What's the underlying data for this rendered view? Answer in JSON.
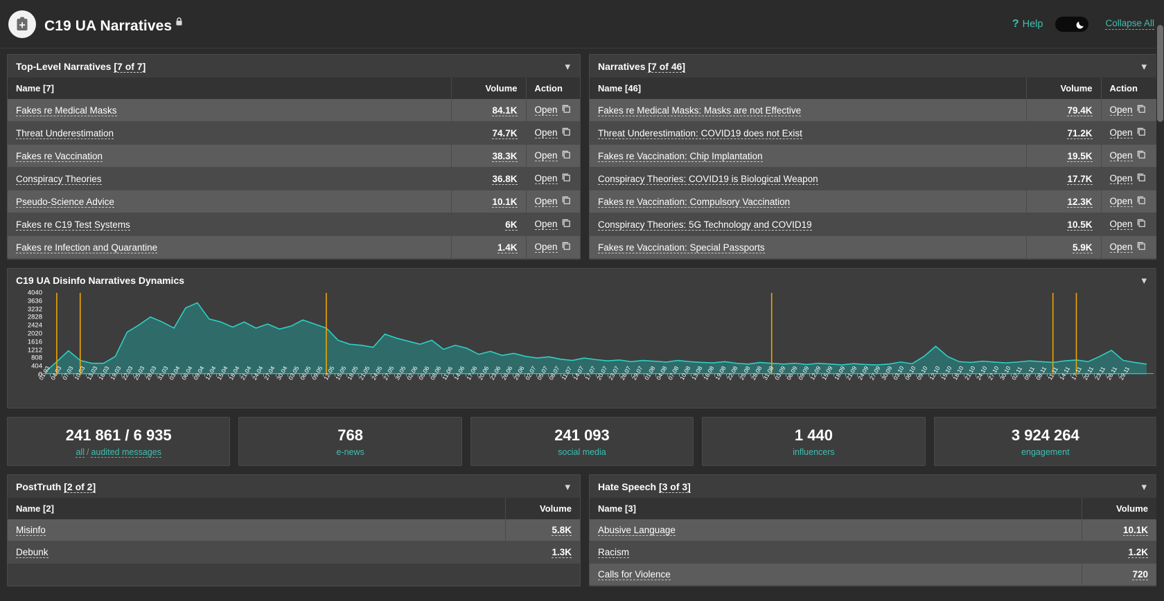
{
  "header": {
    "app_title": "C19 UA Narratives",
    "lock_icon": "lock-icon",
    "logo_icon": "clipboard-plus-icon",
    "help_label": "Help",
    "help_icon": "question-mark-icon",
    "theme_toggle_icon": "moon-icon",
    "collapse_all_label": "Collapse All",
    "accent_color": "#3fbfb0"
  },
  "top_level_narratives": {
    "title": "Top-Level Narratives",
    "count_label": "[7 of 7]",
    "chevron_icon": "chevron-down-icon",
    "columns": [
      "Name [7]",
      "Volume",
      "Action"
    ],
    "action_label": "Open",
    "action_icon": "copy-icon",
    "rows": [
      {
        "name": "Fakes re Medical Masks",
        "volume": "84.1K"
      },
      {
        "name": "Threat Underestimation",
        "volume": "74.7K"
      },
      {
        "name": "Fakes re Vaccination",
        "volume": "38.3K"
      },
      {
        "name": "Conspiracy Theories",
        "volume": "36.8K"
      },
      {
        "name": "Pseudo-Science Advice",
        "volume": "10.1K"
      },
      {
        "name": "Fakes re C19 Test Systems",
        "volume": "6K"
      },
      {
        "name": "Fakes re Infection and Quarantine",
        "volume": "1.4K"
      }
    ]
  },
  "narratives": {
    "title": "Narratives",
    "count_label": "[7 of 46]",
    "chevron_icon": "chevron-down-icon",
    "columns": [
      "Name [46]",
      "Volume",
      "Action"
    ],
    "action_label": "Open",
    "action_icon": "copy-icon",
    "rows": [
      {
        "name": "Fakes re Medical Masks: Masks are not Effective",
        "volume": "79.4K"
      },
      {
        "name": "Threat Underestimation: COVID19 does not Exist",
        "volume": "71.2K"
      },
      {
        "name": "Fakes re Vaccination: Chip Implantation",
        "volume": "19.5K"
      },
      {
        "name": "Conspiracy Theories: COVID19 is Biological Weapon",
        "volume": "17.7K"
      },
      {
        "name": "Fakes re Vaccination: Compulsory Vaccination",
        "volume": "12.3K"
      },
      {
        "name": "Conspiracy Theories: 5G Technology and COVID19",
        "volume": "10.5K"
      },
      {
        "name": "Fakes re Vaccination: Special Passports",
        "volume": "5.9K"
      }
    ]
  },
  "dynamics_panel": {
    "title": "C19 UA Disinfo Narratives Dynamics",
    "chevron_icon": "chevron-down-icon"
  },
  "chart_data": {
    "type": "area",
    "title": "C19 UA Disinfo Narratives Dynamics",
    "xlabel": "",
    "ylabel": "",
    "ylim": [
      0,
      4040
    ],
    "grid": false,
    "legend": "none",
    "line_color": "#2fd0c5",
    "fill_color": "#2f6b69",
    "marker_color": "#f0a500",
    "yticks": [
      4040,
      3636,
      3232,
      2828,
      2424,
      2020,
      1616,
      1212,
      808,
      404,
      0
    ],
    "markers_x": [
      "04.03",
      "10.03",
      "12.05",
      "03.09",
      "14.11",
      "20.11"
    ],
    "x": [
      "01.03",
      "04.03",
      "07.03",
      "10.03",
      "13.03",
      "16.03",
      "19.03",
      "22.03",
      "25.03",
      "28.03",
      "31.03",
      "03.04",
      "06.04",
      "09.04",
      "12.04",
      "15.04",
      "18.04",
      "21.04",
      "24.04",
      "27.04",
      "30.04",
      "03.05",
      "06.05",
      "09.05",
      "12.05",
      "15.05",
      "18.05",
      "21.05",
      "24.05",
      "27.05",
      "30.05",
      "02.06",
      "05.06",
      "08.06",
      "11.06",
      "14.06",
      "17.06",
      "20.06",
      "23.06",
      "26.06",
      "29.06",
      "02.07",
      "05.07",
      "08.07",
      "11.07",
      "14.07",
      "17.07",
      "20.07",
      "23.07",
      "26.07",
      "29.07",
      "01.08",
      "04.08",
      "07.08",
      "10.08",
      "13.08",
      "16.08",
      "19.08",
      "22.08",
      "25.08",
      "28.08",
      "31.08",
      "03.09",
      "06.09",
      "09.09",
      "12.09",
      "15.09",
      "18.09",
      "21.09",
      "24.09",
      "27.09",
      "30.09",
      "03.10",
      "06.10",
      "09.10",
      "12.10",
      "15.10",
      "18.10",
      "21.10",
      "24.10",
      "27.10",
      "30.10",
      "02.11",
      "05.11",
      "08.11",
      "11.11",
      "14.11",
      "17.11",
      "20.11",
      "23.11",
      "26.11",
      "29.11"
    ],
    "values": [
      120,
      640,
      1180,
      700,
      560,
      560,
      900,
      2100,
      2450,
      2850,
      2600,
      2300,
      3300,
      3550,
      2750,
      2600,
      2350,
      2600,
      2300,
      2500,
      2250,
      2400,
      2700,
      2500,
      2300,
      1700,
      1500,
      1450,
      1350,
      2000,
      1800,
      1650,
      1500,
      1700,
      1250,
      1450,
      1300,
      1000,
      1150,
      950,
      1050,
      900,
      820,
      880,
      760,
      700,
      820,
      740,
      680,
      720,
      640,
      700,
      660,
      620,
      700,
      640,
      600,
      580,
      640,
      560,
      520,
      600,
      560,
      520,
      560,
      500,
      560,
      520,
      480,
      540,
      500,
      480,
      520,
      620,
      540,
      900,
      1400,
      900,
      640,
      600,
      660,
      620,
      580,
      620,
      680,
      640,
      600,
      680,
      720,
      640,
      900,
      1200,
      700,
      600,
      520
    ]
  },
  "stats": [
    {
      "value": "241 861 / 6 935",
      "sub_a": "all",
      "sub_sep": "/",
      "sub_b": "audited messages"
    },
    {
      "value": "768",
      "sub_a": "e-news"
    },
    {
      "value": "241 093",
      "sub_a": "social media"
    },
    {
      "value": "1 440",
      "sub_a": "influencers"
    },
    {
      "value": "3 924 264",
      "sub_a": "engagement"
    }
  ],
  "post_truth": {
    "title": "PostTruth",
    "count_label": "[2 of 2]",
    "chevron_icon": "chevron-down-icon",
    "columns": [
      "Name [2]",
      "Volume"
    ],
    "rows": [
      {
        "name": "Misinfo",
        "volume": "5.8K"
      },
      {
        "name": "Debunk",
        "volume": "1.3K"
      }
    ]
  },
  "hate_speech": {
    "title": "Hate Speech",
    "count_label": "[3 of 3]",
    "chevron_icon": "chevron-down-icon",
    "columns": [
      "Name [3]",
      "Volume"
    ],
    "rows": [
      {
        "name": "Abusive Language",
        "volume": "10.1K"
      },
      {
        "name": "Racism",
        "volume": "1.2K"
      },
      {
        "name": "Calls for Violence",
        "volume": "720"
      }
    ]
  }
}
